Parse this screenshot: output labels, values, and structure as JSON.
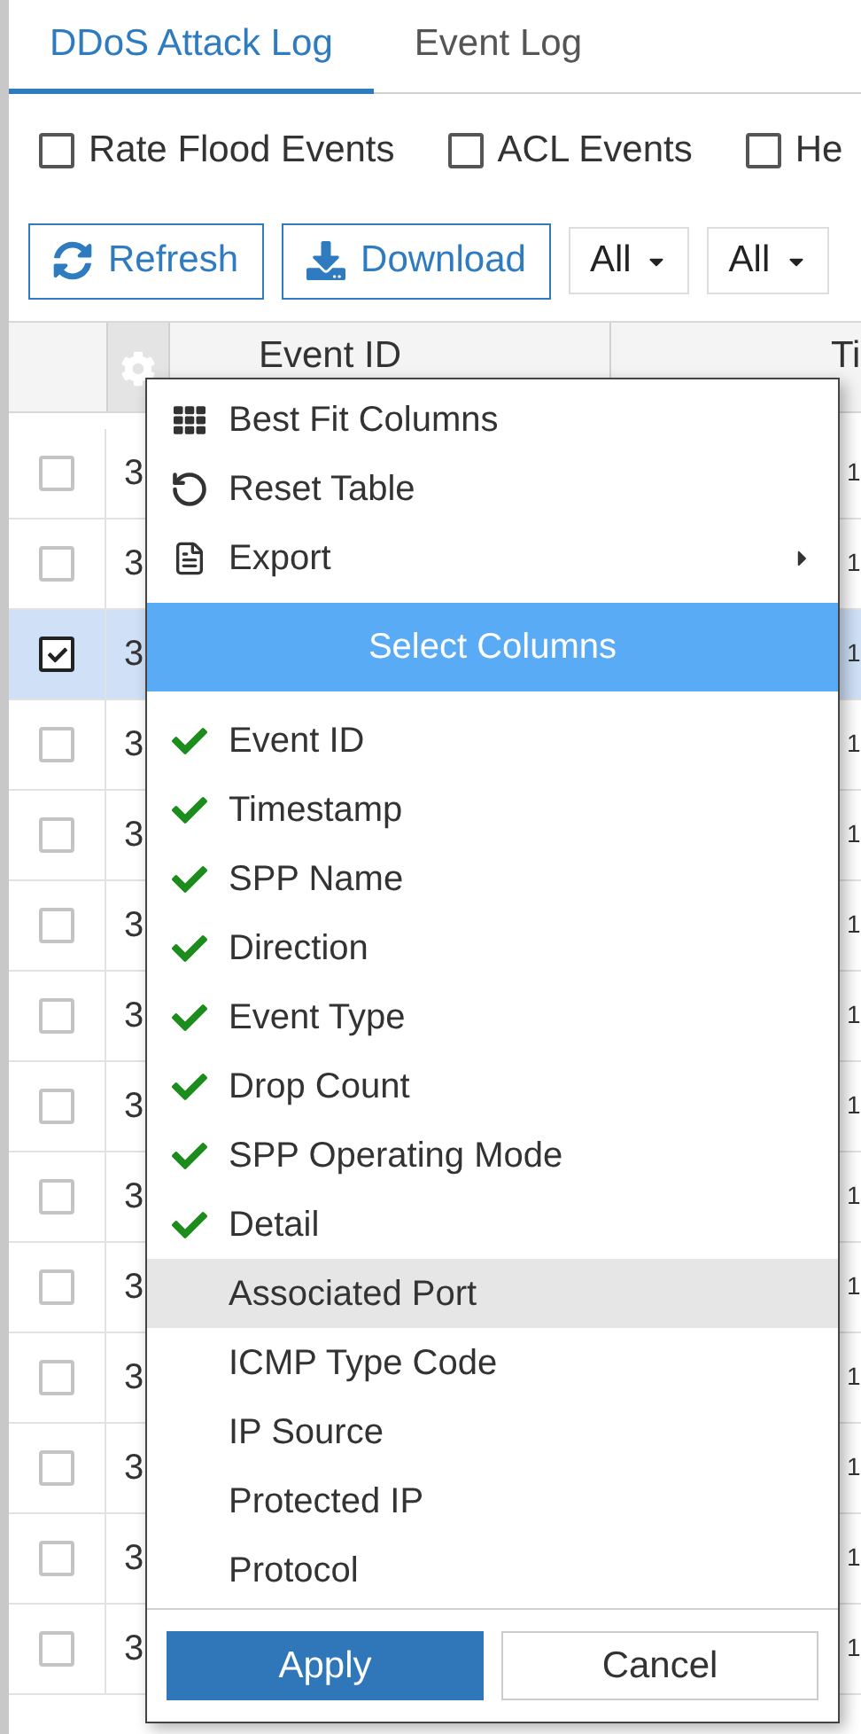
{
  "tabs": [
    {
      "label": "DDoS Attack Log",
      "selected": true
    },
    {
      "label": "Event Log",
      "selected": false
    }
  ],
  "filters": [
    {
      "label": "Rate Flood Events",
      "checked": false
    },
    {
      "label": "ACL Events",
      "checked": false
    },
    {
      "label": "He",
      "checked": false
    }
  ],
  "toolbar": {
    "buttons": [
      {
        "label": "Refresh",
        "kind": "refresh"
      },
      {
        "label": "Download",
        "kind": "download"
      }
    ],
    "dropdowns": [
      {
        "value": "All"
      },
      {
        "value": "All"
      }
    ]
  },
  "table": {
    "columns": [
      "Event ID",
      "Ti"
    ],
    "rows": [
      {
        "event_id": "3",
        "column_3": "1",
        "checked": false,
        "selected": false
      },
      {
        "event_id": "3",
        "column_3": "1",
        "checked": false,
        "selected": false
      },
      {
        "event_id": "3",
        "column_3": "1",
        "checked": true,
        "selected": true
      },
      {
        "event_id": "3",
        "column_3": "1",
        "checked": false,
        "selected": false
      },
      {
        "event_id": "3",
        "column_3": "1",
        "checked": false,
        "selected": false
      },
      {
        "event_id": "3",
        "column_3": "1",
        "checked": false,
        "selected": false
      },
      {
        "event_id": "3",
        "column_3": "1",
        "checked": false,
        "selected": false
      },
      {
        "event_id": "3",
        "column_3": "1",
        "checked": false,
        "selected": false
      },
      {
        "event_id": "3",
        "column_3": "1",
        "checked": false,
        "selected": false
      },
      {
        "event_id": "3",
        "column_3": "1",
        "checked": false,
        "selected": false
      },
      {
        "event_id": "3",
        "column_3": "1",
        "checked": false,
        "selected": false
      },
      {
        "event_id": "3",
        "column_3": "1",
        "checked": false,
        "selected": false
      },
      {
        "event_id": "3",
        "column_3": "1",
        "checked": false,
        "selected": false
      },
      {
        "event_id": "3",
        "column_3": "1",
        "checked": false,
        "selected": false
      }
    ]
  },
  "menu": {
    "actions": [
      {
        "label": "Best Fit Columns",
        "kind": "grid",
        "submenu": false
      },
      {
        "label": "Reset Table",
        "kind": "reset",
        "submenu": false
      },
      {
        "label": "Export",
        "kind": "export",
        "submenu": true
      }
    ],
    "section_title": "Select Columns",
    "columns": [
      {
        "label": "Event ID",
        "checked": true,
        "highlighted": false
      },
      {
        "label": "Timestamp",
        "checked": true,
        "highlighted": false
      },
      {
        "label": "SPP Name",
        "checked": true,
        "highlighted": false
      },
      {
        "label": "Direction",
        "checked": true,
        "highlighted": false
      },
      {
        "label": "Event Type",
        "checked": true,
        "highlighted": false
      },
      {
        "label": "Drop Count",
        "checked": true,
        "highlighted": false
      },
      {
        "label": "SPP Operating Mode",
        "checked": true,
        "highlighted": false
      },
      {
        "label": "Detail",
        "checked": true,
        "highlighted": false
      },
      {
        "label": "Associated Port",
        "checked": false,
        "highlighted": true
      },
      {
        "label": "ICMP Type Code",
        "checked": false,
        "highlighted": false
      },
      {
        "label": "IP Source",
        "checked": false,
        "highlighted": false
      },
      {
        "label": "Protected IP",
        "checked": false,
        "highlighted": false
      },
      {
        "label": "Protocol",
        "checked": false,
        "highlighted": false
      }
    ],
    "apply": "Apply",
    "cancel": "Cancel"
  }
}
